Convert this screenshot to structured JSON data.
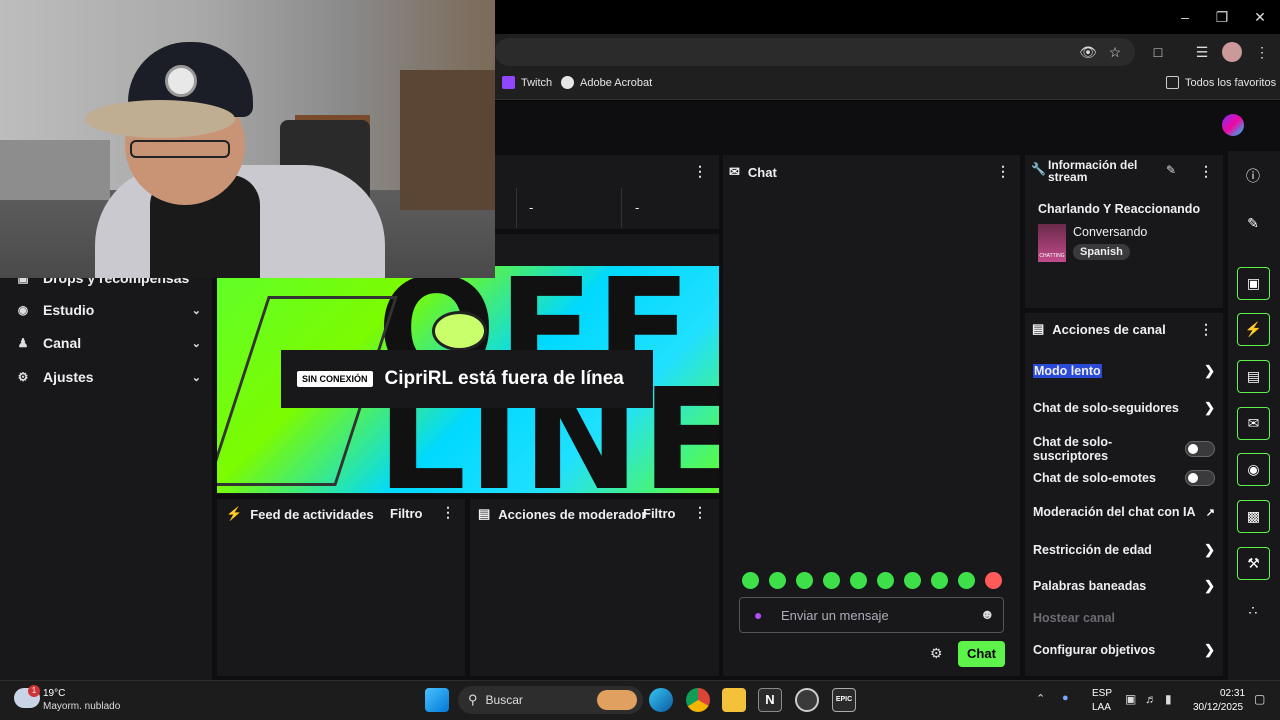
{
  "browser": {
    "bookmarks": [
      {
        "label": "Twitch",
        "color": "#9146ff"
      },
      {
        "label": "Adobe Acrobat",
        "color": "#e6e6e6"
      }
    ],
    "all_bookmarks": "Todos los favoritos"
  },
  "sidebar": {
    "items": [
      {
        "label": "Drops y recompensas",
        "icon": "gift-icon"
      },
      {
        "label": "Estudio",
        "icon": "studio-icon"
      },
      {
        "label": "Canal",
        "icon": "users-icon"
      },
      {
        "label": "Ajustes",
        "icon": "gear-icon"
      }
    ]
  },
  "stats": {
    "values": [
      "-",
      "-"
    ]
  },
  "video": {
    "offline_badge": "SIN CONEXIÓN",
    "offline_text": "CipriRL está fuera de línea",
    "background_letters": "OFF\nLINE"
  },
  "activity_feed": {
    "title": "Feed de actividades",
    "filter": "Filtro"
  },
  "mod_actions": {
    "title": "Acciones de moderador",
    "filter": "Filtro"
  },
  "chat": {
    "title": "Chat",
    "placeholder": "Enviar un mensaje",
    "send_label": "Chat",
    "accent": "#5ef34a"
  },
  "stream_info": {
    "title": "Información del stream",
    "stream_title": "Charlando Y Reaccionando",
    "category": "Conversando",
    "language": "Spanish",
    "category_image_label": "CHATTING"
  },
  "channel_actions": {
    "title": "Acciones de canal",
    "items": [
      {
        "label": "Modo lento",
        "control": "arrow",
        "highlighted": true
      },
      {
        "label": "Chat de solo-seguidores",
        "control": "arrow"
      },
      {
        "label": "Chat de solo-suscriptores",
        "control": "toggle",
        "on": false
      },
      {
        "label": "Chat de solo-emotes",
        "control": "toggle",
        "on": false
      },
      {
        "label": "Moderación del chat con IA",
        "control": "external"
      },
      {
        "label": "Restricción de edad",
        "control": "arrow"
      },
      {
        "label": "Palabras baneadas",
        "control": "arrow"
      },
      {
        "label": "Hostear canal",
        "control": "none",
        "disabled": true
      },
      {
        "label": "Configurar objetivos",
        "control": "arrow"
      }
    ]
  },
  "taskbar": {
    "weather_temp": "19°C",
    "weather_desc": "Mayorm. nublado",
    "weather_badge": "1",
    "search_label": "Buscar",
    "lang_top": "ESP",
    "lang_bottom": "LAA",
    "time": "02:31",
    "date": "30/12/2025"
  }
}
